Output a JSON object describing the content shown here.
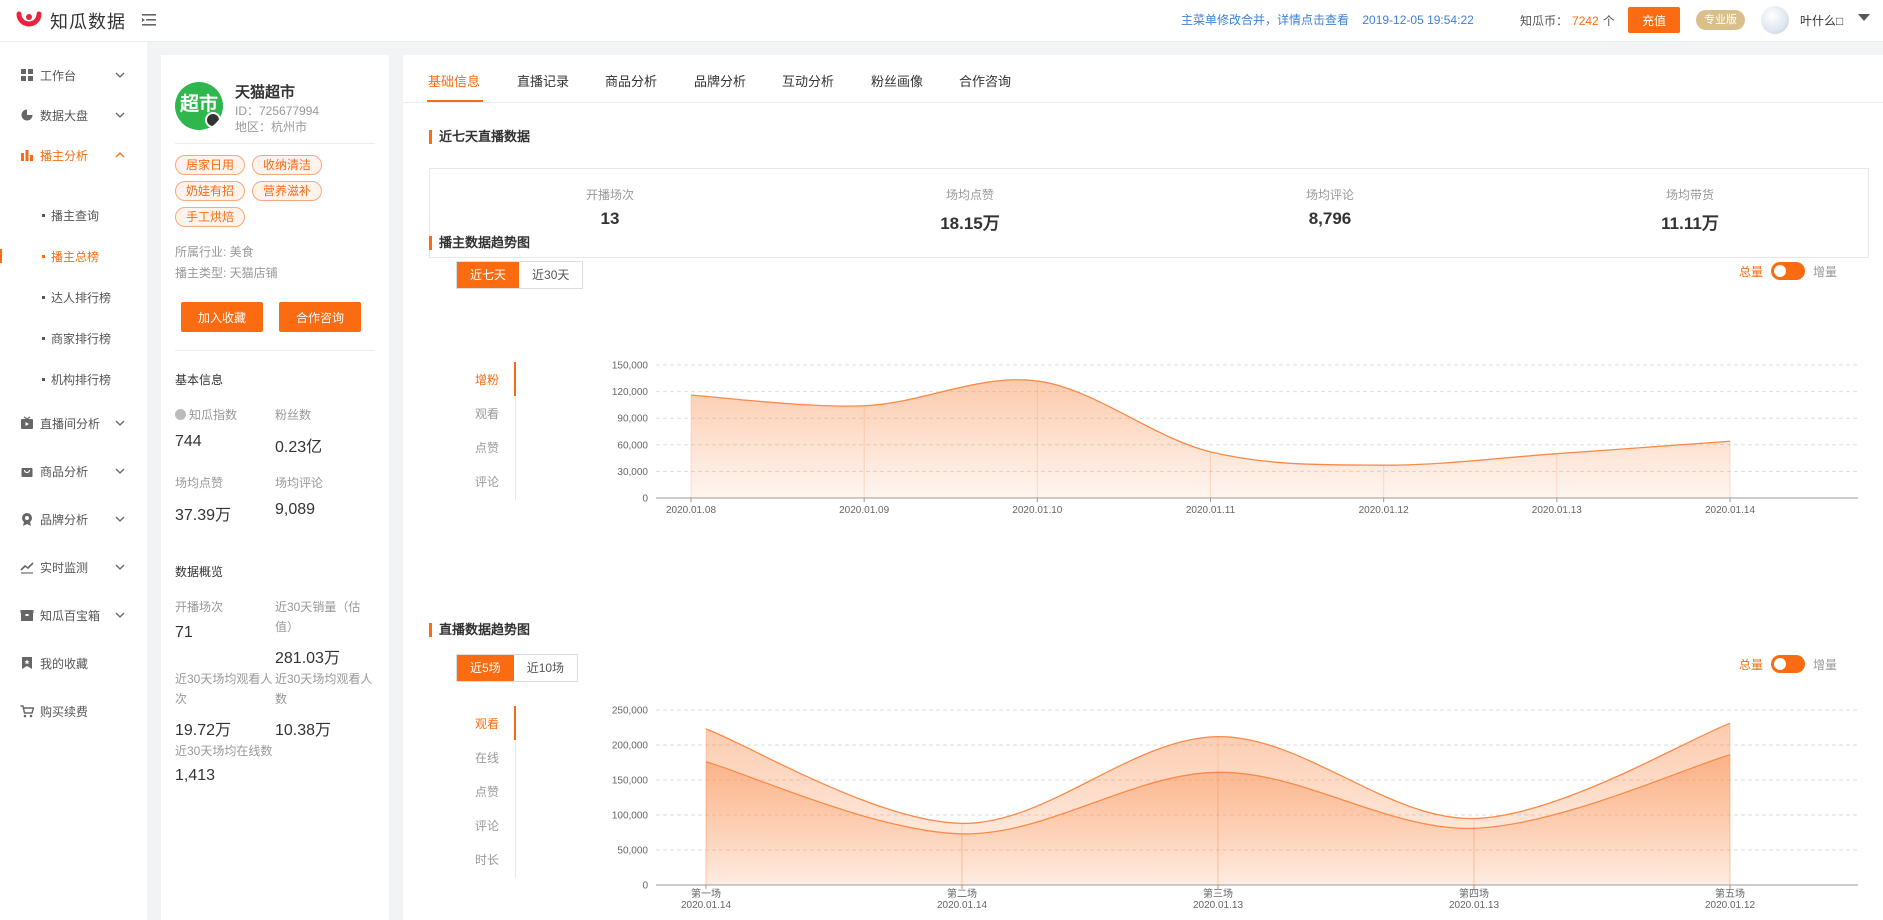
{
  "app": {
    "name": "知瓜数据",
    "notice": "主菜单修改合并，详情点击查看",
    "datetime": "2019-12-05 19:54:22",
    "coins_label": "知瓜币：",
    "coins_value": "7242",
    "coins_unit": "个",
    "recharge": "充值",
    "plan": "专业版",
    "username": "叶什么□",
    "brand_color": "#fa6b12"
  },
  "sidebar": {
    "items": [
      {
        "label": "工作台",
        "icon": "grid-icon"
      },
      {
        "label": "数据大盘",
        "icon": "pie-icon"
      },
      {
        "label": "播主分析",
        "icon": "bar-icon",
        "active": true
      },
      {
        "label": "直播间分析",
        "icon": "tv-icon"
      },
      {
        "label": "商品分析",
        "icon": "bag-icon"
      },
      {
        "label": "品牌分析",
        "icon": "badge-icon"
      },
      {
        "label": "实时监测",
        "icon": "line-icon"
      },
      {
        "label": "知瓜百宝箱",
        "icon": "box-icon"
      },
      {
        "label": "我的收藏",
        "icon": "bookmark-icon"
      },
      {
        "label": "购买续费",
        "icon": "cart-icon"
      }
    ],
    "sub_items": [
      {
        "label": "播主查询"
      },
      {
        "label": "播主总榜",
        "active": true
      },
      {
        "label": "达人排行榜"
      },
      {
        "label": "商家排行榜"
      },
      {
        "label": "机构排行榜"
      }
    ]
  },
  "profile": {
    "logo_text": "超市",
    "name": "天猫超市",
    "id": "ID：725677994",
    "region": "地区：杭州市",
    "tags": [
      "居家日用",
      "收纳清洁",
      "奶娃有招",
      "营养滋补",
      "手工烘焙"
    ],
    "industry": "所属行业: 美食",
    "type": "播主类型: 天猫店铺",
    "btn_fav": "加入收藏",
    "btn_contact": "合作咨询",
    "basic_title": "基本信息",
    "basic": [
      {
        "label": "知瓜指数",
        "value": "744"
      },
      {
        "label": "粉丝数",
        "value": "0.23亿"
      },
      {
        "label": "场均点赞",
        "value": "37.39万"
      },
      {
        "label": "场均评论",
        "value": "9,089"
      }
    ],
    "overview_title": "数据概览",
    "overview": [
      {
        "label": "开播场次",
        "value": "71"
      },
      {
        "label": "近30天销量（估值）",
        "value": "281.03万"
      },
      {
        "label": "近30天场均观看人次",
        "value": "19.72万"
      },
      {
        "label": "近30天场均观看人数",
        "value": "10.38万"
      },
      {
        "label": "近30天场均在线数",
        "value": "1,413"
      }
    ]
  },
  "tabs": [
    "基础信息",
    "直播记录",
    "商品分析",
    "品牌分析",
    "互动分析",
    "粉丝画像",
    "合作咨询"
  ],
  "seven_day": {
    "title": "近七天直播数据",
    "stats": [
      {
        "label": "开播场次",
        "value": "13"
      },
      {
        "label": "场均点赞",
        "value": "18.15万"
      },
      {
        "label": "场均评论",
        "value": "8,796"
      },
      {
        "label": "场均带货",
        "value": "11.11万"
      }
    ]
  },
  "trend1": {
    "title": "播主数据趋势图",
    "ranges": [
      "近七天",
      "近30天"
    ],
    "toggle_on": "总量",
    "toggle_off": "增量",
    "metrics": [
      "增粉",
      "观看",
      "点赞",
      "评论"
    ]
  },
  "trend2": {
    "title": "直播数据趋势图",
    "ranges": [
      "近5场",
      "近10场"
    ],
    "toggle_on": "总量",
    "toggle_off": "增量",
    "metrics": [
      "观看",
      "在线",
      "点赞",
      "评论",
      "时长"
    ]
  },
  "chart_data": [
    {
      "type": "area",
      "title": "",
      "x": [
        "2020.01.08",
        "2020.01.09",
        "2020.01.10",
        "2020.01.11",
        "2020.01.12",
        "2020.01.13",
        "2020.01.14"
      ],
      "series": [
        {
          "values": [
            116000,
            104000,
            132000,
            52000,
            37000,
            50000,
            64000
          ]
        }
      ],
      "ylim": [
        0,
        150000
      ],
      "yticks": [
        "150,000",
        "120,000",
        "90,000",
        "60,000",
        "30,000",
        "0"
      ],
      "grid": true,
      "color": "#fa8a48"
    },
    {
      "type": "area",
      "title": "",
      "x": [
        "第一场",
        "第二场",
        "第三场",
        "第四场",
        "第五场"
      ],
      "x_sub": [
        "2020.01.14",
        "2020.01.14",
        "2020.01.13",
        "2020.01.13",
        "2020.01.12"
      ],
      "series": [
        {
          "values": [
            223000,
            88000,
            212000,
            95000,
            231000
          ]
        },
        {
          "values": [
            176000,
            73000,
            161000,
            81000,
            186000
          ]
        }
      ],
      "ylim": [
        0,
        250000
      ],
      "yticks": [
        "250,000",
        "200,000",
        "150,000",
        "100,000",
        "50,000",
        "0"
      ],
      "grid": true,
      "color": "#fa8a48"
    }
  ]
}
